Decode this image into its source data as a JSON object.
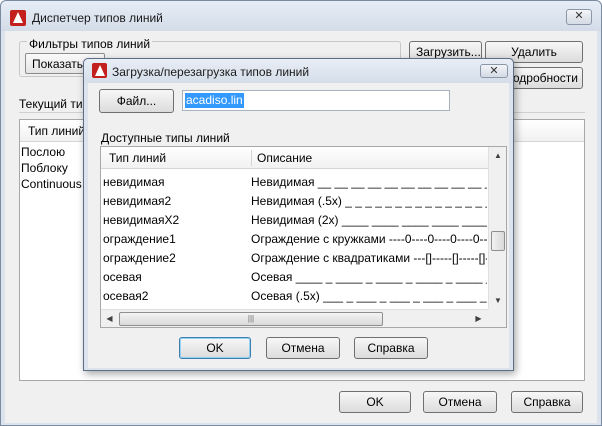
{
  "outer": {
    "title": "Диспетчер типов линий",
    "close_label": "✕",
    "filters_label": "Фильтры типов линий",
    "show_combo": "Показать в",
    "load_button": "Загрузить...",
    "delete_button": "Удалить",
    "details_button": "одробности",
    "current_label": "Текущий тип",
    "list_header": "Тип линий",
    "rows": [
      "Послою",
      "Поблоку",
      "Continuous"
    ],
    "ok": "OK",
    "cancel": "Отмена",
    "help": "Справка"
  },
  "inner": {
    "title": "Загрузка/перезагрузка типов линий",
    "close_label": "✕",
    "file_button": "Файл...",
    "file_value": "acadiso.lin",
    "available_label": "Доступные типы линий",
    "col_name": "Тип линий",
    "col_desc": "Описание",
    "linetypes": [
      {
        "name": "невидимая",
        "desc": "Невидимая __ __ __ __ __ __ __ __ __ __ __ __ __"
      },
      {
        "name": "невидимая2",
        "desc": "Невидимая (.5x) _ _ _ _ _ _ _ _ _ _ _ _ _ _ _ _ _ _"
      },
      {
        "name": "невидимаяX2",
        "desc": "Невидимая (2x) ____ ____ ____ ____ ____ ____"
      },
      {
        "name": "ограждение1",
        "desc": "Ограждение с кружками ----0----0----0----0----0----"
      },
      {
        "name": "ограждение2",
        "desc": "Ограждение с квадратиками ---[]-----[]-----[]-----[]---"
      },
      {
        "name": "осевая",
        "desc": "Осевая ____ _ ____ _ ____ _ ____ _ ____ _ ____"
      },
      {
        "name": "осевая2",
        "desc": "Осевая (.5x) ___ _ ___ _ ___ _ ___ _ ___ _ ___"
      }
    ],
    "ok": "OK",
    "cancel": "Отмена",
    "help": "Справка"
  },
  "icons": {
    "app_icon": "autocad-logo-icon",
    "scroll_up": "▲",
    "scroll_down": "▼",
    "scroll_left": "◀",
    "scroll_right": "▶",
    "thumb_grip": "|||"
  },
  "colors": {
    "app_icon": "#c41f1f",
    "selection": "#3399ff",
    "default_button_border": "#3c7fb1"
  }
}
